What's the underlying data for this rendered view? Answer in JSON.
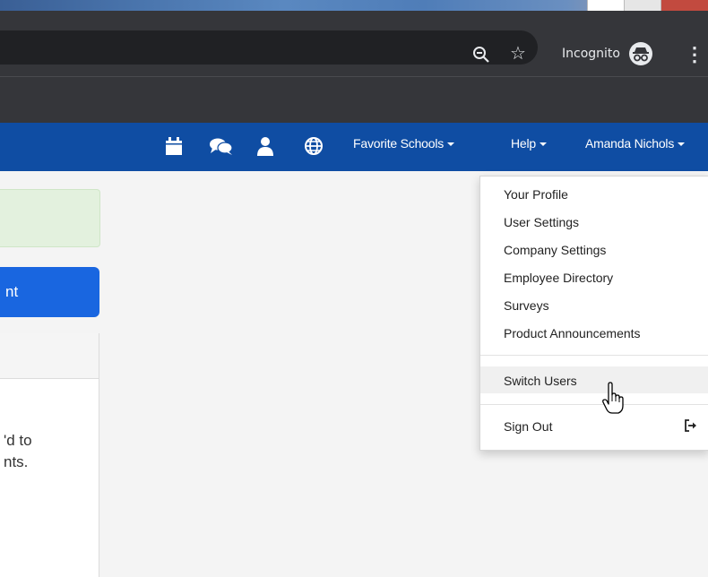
{
  "browser": {
    "incognito_label": "Incognito",
    "icons": [
      "zoom-icon",
      "star-icon",
      "incognito-icon",
      "menu-icon"
    ],
    "menu_glyph": "⋮",
    "star_glyph": "☆"
  },
  "nav": {
    "icons": [
      "calendar-icon",
      "chat-icon",
      "user-icon",
      "globe-icon"
    ],
    "favorite_schools": "Favorite Schools",
    "help": "Help",
    "user_name": "Amanda Nichols"
  },
  "left": {
    "button_fragment": "nt",
    "text_line1": "'d to",
    "text_line2": "nts."
  },
  "dropdown": {
    "items": [
      {
        "label": "Your Profile"
      },
      {
        "label": "User Settings"
      },
      {
        "label": "Company Settings"
      },
      {
        "label": "Employee Directory"
      },
      {
        "label": "Surveys"
      },
      {
        "label": "Product Announcements"
      },
      {
        "label": "Switch Users"
      },
      {
        "label": "Sign Out"
      }
    ],
    "hovered_index": 6
  },
  "colors": {
    "nav_bg": "#0f4da3",
    "chrome_toolbar": "#35363a",
    "primary_button": "#1966e0",
    "success_bg": "#e3f1de"
  }
}
